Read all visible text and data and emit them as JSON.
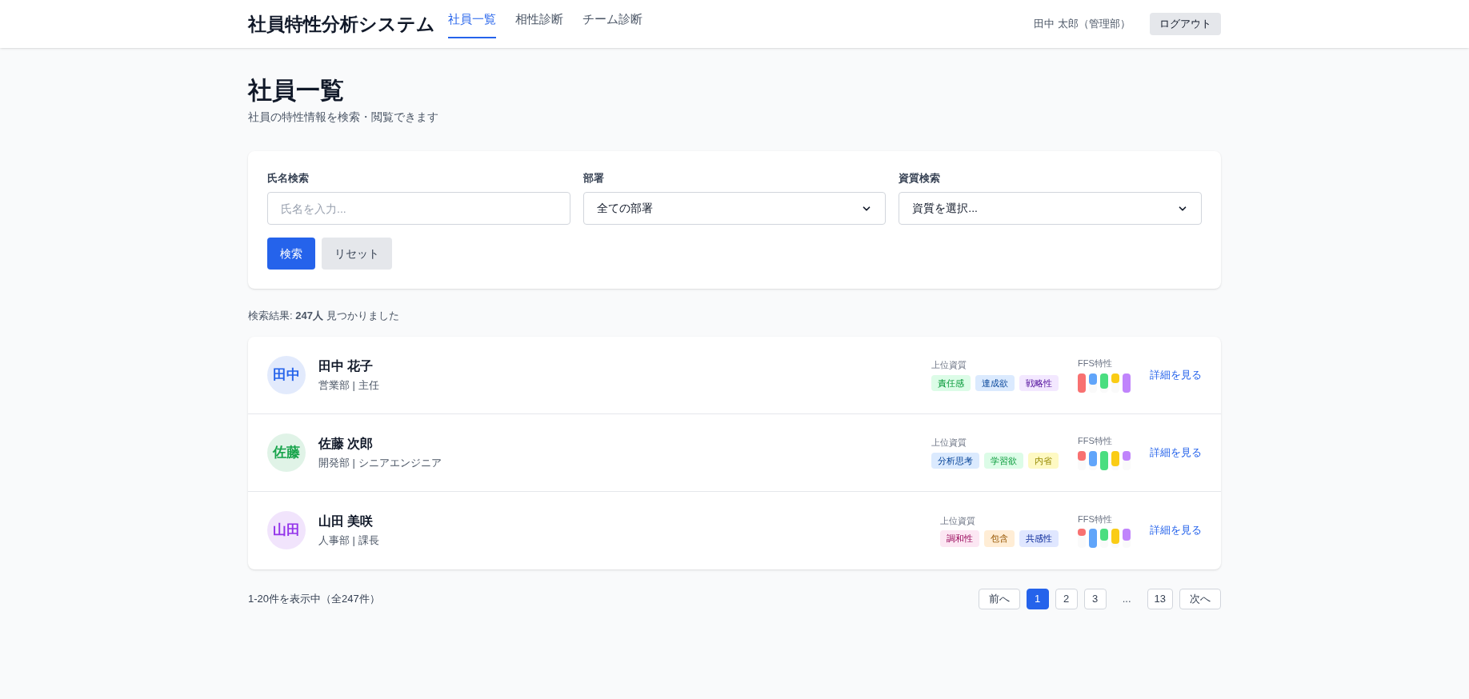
{
  "header": {
    "app_title": "社員特性分析システム",
    "nav": [
      {
        "label": "社員一覧",
        "selected": true
      },
      {
        "label": "相性診断",
        "selected": false
      },
      {
        "label": "チーム診断",
        "selected": false
      }
    ],
    "user": "田中 太郎（管理部）",
    "logout": "ログアウト"
  },
  "page": {
    "title": "社員一覧",
    "subtitle": "社員の特性情報を検索・閲覧できます"
  },
  "filters": {
    "name": {
      "label": "氏名検索",
      "placeholder": "氏名を入力..."
    },
    "department": {
      "label": "部署",
      "value": "全ての部署"
    },
    "trait": {
      "label": "資質検索",
      "value": "資質を選択..."
    },
    "search_button": "検索",
    "reset_button": "リセット"
  },
  "results": "検索結果: **247人** 見つかりました",
  "employees": [
    {
      "initials": "田中",
      "color": "#2563eb",
      "name": "田中 花子",
      "role": "営業部 | 主任",
      "traits_label": "上位資質",
      "traits": [
        {
          "label": "責任感",
          "color": "#dcfce7"
        },
        {
          "label": "達成欲",
          "color": "#dbeafe"
        },
        {
          "label": "戦略性",
          "color": "#f3e8ff"
        }
      ],
      "ffs_label": "FFS特性",
      "ffs": [
        {
          "color": "#f87171",
          "level": 1.0
        },
        {
          "color": "#60a5fa",
          "level": 0.6
        },
        {
          "color": "#4ade80",
          "level": 0.8
        },
        {
          "color": "#facc15",
          "level": 0.5
        },
        {
          "color": "#c084fc",
          "level": 1.0
        }
      ],
      "link": "詳細を見る"
    },
    {
      "initials": "佐藤",
      "color": "#16a34a",
      "name": "佐藤 次郎",
      "role": "開発部 | シニアエンジニア",
      "traits_label": "上位資質",
      "traits": [
        {
          "label": "分析思考",
          "color": "#dbeafe"
        },
        {
          "label": "学習欲",
          "color": "#dcfce7"
        },
        {
          "label": "内省",
          "color": "#fef9c3"
        }
      ],
      "ffs_label": "FFS特性",
      "ffs": [
        {
          "color": "#f87171",
          "level": 0.5
        },
        {
          "color": "#60a5fa",
          "level": 0.8
        },
        {
          "color": "#4ade80",
          "level": 1.0
        },
        {
          "color": "#facc15",
          "level": 0.8
        },
        {
          "color": "#c084fc",
          "level": 0.5
        }
      ],
      "link": "詳細を見る"
    },
    {
      "initials": "山田",
      "color": "#9333ea",
      "name": "山田 美咲",
      "role": "人事部 | 課長",
      "traits_label": "上位資質",
      "traits": [
        {
          "label": "調和性",
          "color": "#fce7f3"
        },
        {
          "label": "包含",
          "color": "#ffedd5"
        },
        {
          "label": "共感性",
          "color": "#e0e7ff"
        }
      ],
      "ffs_label": "FFS特性",
      "ffs": [
        {
          "color": "#f87171",
          "level": 0.35
        },
        {
          "color": "#60a5fa",
          "level": 1.0
        },
        {
          "color": "#4ade80",
          "level": 0.6
        },
        {
          "color": "#facc15",
          "level": 0.8
        },
        {
          "color": "#c084fc",
          "level": 0.6
        }
      ],
      "link": "詳細を見る"
    }
  ],
  "pagination": {
    "summary": "1-20件を表示中（全247件）",
    "prev": "前へ",
    "pages": [
      {
        "label": "1",
        "selected": true
      },
      {
        "label": "2",
        "selected": false
      },
      {
        "label": "3",
        "selected": false
      }
    ],
    "ellipsis": "...",
    "last": {
      "label": "13",
      "selected": false
    },
    "next": "次へ"
  }
}
